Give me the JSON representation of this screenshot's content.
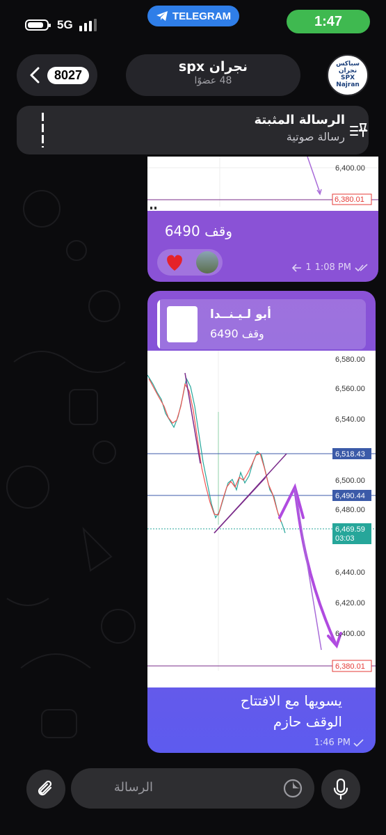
{
  "status": {
    "network": "5G",
    "telegram_label": "TELEGRAM",
    "time": "1:47"
  },
  "header": {
    "back_count": "8027",
    "title": "نجران spx",
    "subtitle": "48 عضوًا",
    "avatar_text_ar": "سباكس نجران",
    "avatar_text_en": "SPX Najran"
  },
  "pinned": {
    "title": "الرسالة المثبتة",
    "subtitle": "رسالة صوتية"
  },
  "message1": {
    "chart_levels": [
      "6,400.00",
      "6,380.01"
    ],
    "text": "وقف 6490",
    "reply_count": "1",
    "time": "1:08 PM"
  },
  "message2": {
    "reply_name": "أبو لـيـنــدا",
    "reply_text": "وقف 6490",
    "chart_axis": [
      "6,580.00",
      "6,560.00",
      "6,540.00",
      "6,500.00",
      "6,480.00",
      "6,440.00",
      "6,420.00",
      "6,400.00"
    ],
    "level_tags": {
      "top": "6,518.43",
      "mid": "6,490.44",
      "price": "6,469.59",
      "countdown": "03:03",
      "bottom": "6,380.01"
    },
    "text_line1": "يسويها مع الافتتاح",
    "text_line2": "الوقف حازم",
    "time": "1:46 PM"
  },
  "composer": {
    "placeholder": "الرسالة"
  },
  "colors": {
    "accent_green": "#3fb950",
    "bubble_purple": "#8a52d6",
    "bubble_blue": "#5d5bef",
    "telegram_blue": "#2f7ee8"
  }
}
